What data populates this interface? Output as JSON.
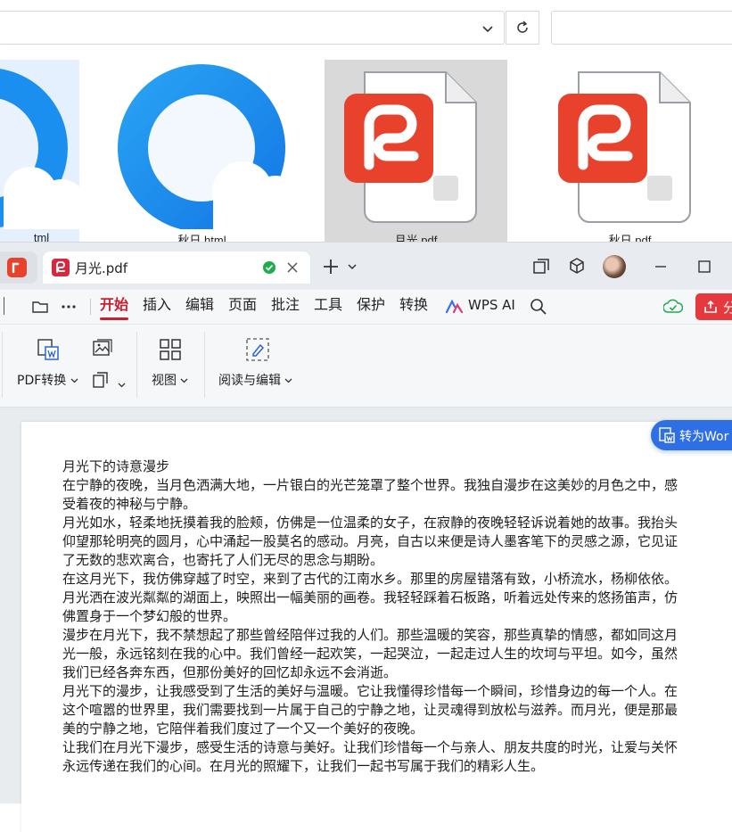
{
  "explorer": {
    "files": [
      {
        "name": "tml",
        "type": "html"
      },
      {
        "name": "秋日.html",
        "type": "html"
      },
      {
        "name": "月光.pdf",
        "type": "pdf"
      },
      {
        "name": "秋日.pdf",
        "type": "pdf"
      }
    ]
  },
  "wps": {
    "tabs": {
      "active_title": "月光.pdf"
    },
    "menu": [
      "开始",
      "插入",
      "编辑",
      "页面",
      "批注",
      "工具",
      "保护",
      "转换",
      "WPS AI"
    ],
    "share_label": "分",
    "ribbon": {
      "pdf_convert": "PDF转换",
      "view": "视图",
      "read_edit": "阅读与编辑"
    },
    "convert_word": "转为Wor",
    "accent": "#c8202f",
    "blue": "#2f6fe6"
  },
  "document": {
    "title": "月光下的诗意漫步",
    "paragraphs": [
      "在宁静的夜晚，当月色洒满大地，一片银白的光芒笼罩了整个世界。我独自漫步在这美妙的月色之中，感受着夜的神秘与宁静。",
      "月光如水，轻柔地抚摸着我的脸颊，仿佛是一位温柔的女子，在寂静的夜晚轻轻诉说着她的故事。我抬头仰望那轮明亮的圆月，心中涌起一股莫名的感动。月亮，自古以来便是诗人墨客笔下的灵感之源，它见证了无数的悲欢离合，也寄托了人们无尽的思念与期盼。",
      "在这月光下，我仿佛穿越了时空，来到了古代的江南水乡。那里的房屋错落有致，小桥流水，杨柳依依。月光洒在波光粼粼的湖面上，映照出一幅美丽的画卷。我轻轻踩着石板路，听着远处传来的悠扬笛声，仿佛置身于一个梦幻般的世界。",
      "漫步在月光下，我不禁想起了那些曾经陪伴过我的人们。那些温暖的笑容，那些真挚的情感，都如同这月光一般，永远铭刻在我的心中。我们曾经一起欢笑，一起哭泣，一起走过人生的坎坷与平坦。如今，虽然我们已经各奔东西，但那份美好的回忆却永远不会消逝。",
      "月光下的漫步，让我感受到了生活的美好与温暖。它让我懂得珍惜每一个瞬间，珍惜身边的每一个人。在这个喧嚣的世界里，我们需要找到一片属于自己的宁静之地，让灵魂得到放松与滋养。而月光，便是那最美的宁静之地，它陪伴着我们度过了一个又一个美好的夜晚。",
      "让我们在月光下漫步，感受生活的诗意与美好。让我们珍惜每一个与亲人、朋友共度的时光，让爱与关怀永远传递在我们的心间。在月光的照耀下，让我们一起书写属于我们的精彩人生。"
    ]
  }
}
